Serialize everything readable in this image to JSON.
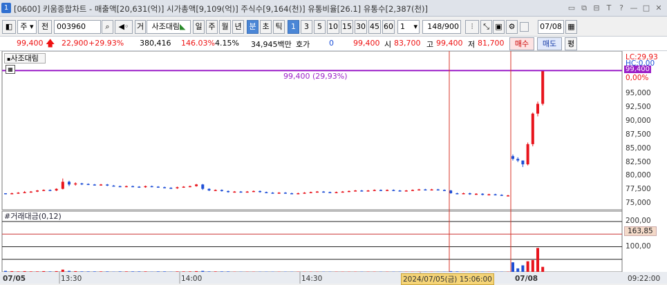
{
  "window": {
    "number": "1",
    "title": "[0600] 키움종합차트 - 매출액[20,631(억)] 시가총액[9,109(억)] 주식수[9,164(천)] 유통비율[26.1] 유통수[2,387(천)]"
  },
  "toolbar": {
    "period_button": "주",
    "prev_label": "전",
    "stock_code": "003960",
    "stock_name_prefix": "거",
    "stock_name": "사조대림",
    "periods": [
      "일",
      "주",
      "월",
      "년",
      "분",
      "초",
      "틱"
    ],
    "selected_period": "분",
    "intervals": [
      "1",
      "3",
      "5",
      "10",
      "15",
      "30",
      "45",
      "60"
    ],
    "selected_interval": "1",
    "interval_select_value": "1",
    "count": "148",
    "count_total": "/900",
    "date": "07/08"
  },
  "quote": {
    "price": "99,400",
    "change": "22,900",
    "change_pct": "+29.93%",
    "volume": "380,416",
    "volume_pct": "146.03%",
    "turnover": "4.15%",
    "amount": "34,945백만",
    "hoga_label": "호가",
    "hoga_value": "0",
    "ask": "99,400",
    "open_label": "시",
    "open": "83,700",
    "high_label": "고",
    "high": "99,400",
    "low_label": "저",
    "low": "81,700",
    "buy_button": "매수",
    "sell_button": "매도",
    "eval_button": "평"
  },
  "price_panel": {
    "stock_label": "사조대림",
    "annotation": "99,400 (29,93%)",
    "lc_label": "LC:29,93",
    "hc_label": "HC:0,00",
    "current_tag": "99,400",
    "pct_tag": "0,00%",
    "y_ticks": [
      "95,000",
      "92,500",
      "90,000",
      "87,500",
      "85,000",
      "82,500",
      "80,000",
      "77,500",
      "75,000"
    ]
  },
  "volume_panel": {
    "label": "#거래대금(0,12)",
    "y_ticks": [
      "200,00",
      "100,00"
    ],
    "current_tag": "163,85"
  },
  "x_axis": {
    "labels": [
      "07/05",
      "13:30",
      "14:00",
      "14:30",
      "07/08",
      "09:22:00"
    ],
    "cursor_time": "2024/07/05(금) 15:06:00"
  },
  "colors": {
    "up": "#e8141c",
    "down": "#1f4fd6",
    "accent_line": "#9b1fc8",
    "cursor_line": "#d8352a",
    "tag_red": "#e8141c",
    "tag_purple": "#9b1fc8"
  },
  "chart_data": {
    "type": "candlestick",
    "series": [
      {
        "name": "price",
        "values": [
          [
            76900,
            76900,
            76700,
            76800
          ],
          [
            76800,
            77000,
            76700,
            76900
          ],
          [
            76900,
            77100,
            76800,
            77000
          ],
          [
            77000,
            77300,
            76900,
            77100
          ],
          [
            77100,
            77300,
            77000,
            77200
          ],
          [
            77200,
            77500,
            77100,
            77400
          ],
          [
            77400,
            77600,
            77300,
            77500
          ],
          [
            77500,
            77600,
            77300,
            77400
          ],
          [
            77400,
            77800,
            77300,
            77700
          ],
          [
            77700,
            79600,
            77600,
            79000
          ],
          [
            79000,
            79200,
            78200,
            78500
          ],
          [
            78500,
            78900,
            78300,
            78700
          ],
          [
            78700,
            78800,
            78400,
            78600
          ],
          [
            78600,
            78700,
            78400,
            78500
          ],
          [
            78500,
            78600,
            78300,
            78400
          ],
          [
            78400,
            78600,
            78300,
            78500
          ],
          [
            78500,
            78600,
            78200,
            78300
          ],
          [
            78300,
            78400,
            78100,
            78200
          ],
          [
            78200,
            78300,
            78000,
            78100
          ],
          [
            78100,
            78300,
            78000,
            78200
          ],
          [
            78200,
            78300,
            78000,
            78100
          ],
          [
            78100,
            78200,
            77900,
            78000
          ],
          [
            78000,
            78300,
            77900,
            78200
          ],
          [
            78200,
            78300,
            78000,
            78100
          ],
          [
            78100,
            78200,
            77900,
            78000
          ],
          [
            78000,
            78100,
            77800,
            77900
          ],
          [
            77900,
            78000,
            77700,
            77800
          ],
          [
            77800,
            78100,
            77700,
            78000
          ],
          [
            78000,
            78200,
            77900,
            78100
          ],
          [
            78100,
            78300,
            78000,
            78200
          ],
          [
            78200,
            78600,
            78100,
            78500
          ],
          [
            78500,
            78600,
            77500,
            77700
          ],
          [
            77700,
            77800,
            77300,
            77400
          ],
          [
            77400,
            77600,
            77300,
            77500
          ],
          [
            77500,
            77600,
            77200,
            77300
          ],
          [
            77300,
            77400,
            77000,
            77100
          ],
          [
            77100,
            77300,
            77000,
            77200
          ],
          [
            77200,
            77300,
            77000,
            77100
          ],
          [
            77100,
            77300,
            77000,
            77200
          ],
          [
            77200,
            77400,
            77100,
            77300
          ],
          [
            77300,
            77400,
            77000,
            77100
          ],
          [
            77100,
            77200,
            76900,
            77000
          ],
          [
            77000,
            77100,
            76800,
            76900
          ],
          [
            76900,
            77100,
            76800,
            77000
          ],
          [
            77000,
            77100,
            76800,
            76900
          ],
          [
            76900,
            77000,
            76700,
            76800
          ],
          [
            76800,
            77000,
            76700,
            76900
          ],
          [
            76900,
            77100,
            76800,
            77000
          ],
          [
            77000,
            77200,
            76900,
            77100
          ],
          [
            77100,
            77300,
            77000,
            77200
          ],
          [
            77200,
            77300,
            77000,
            77100
          ],
          [
            77100,
            77200,
            76900,
            77000
          ],
          [
            77000,
            77200,
            76900,
            77100
          ],
          [
            77100,
            77300,
            77000,
            77200
          ],
          [
            77200,
            77400,
            77100,
            77300
          ],
          [
            77300,
            77500,
            77200,
            77400
          ],
          [
            77400,
            77500,
            77200,
            77300
          ],
          [
            77300,
            77500,
            77200,
            77400
          ],
          [
            77400,
            77600,
            77300,
            77500
          ],
          [
            77500,
            77600,
            77300,
            77400
          ],
          [
            77400,
            77600,
            77300,
            77500
          ],
          [
            77500,
            77600,
            77300,
            77400
          ],
          [
            77400,
            77500,
            77200,
            77300
          ],
          [
            77300,
            77500,
            77200,
            77400
          ],
          [
            77400,
            77600,
            77300,
            77500
          ],
          [
            77500,
            77700,
            77400,
            77600
          ],
          [
            77600,
            77700,
            77400,
            77500
          ],
          [
            77500,
            77700,
            77400,
            77600
          ],
          [
            77600,
            77700,
            77400,
            77500
          ],
          [
            77500,
            77600,
            77300,
            77400
          ],
          [
            77400,
            77500,
            76800,
            76900
          ],
          [
            76900,
            77000,
            76700,
            76800
          ],
          [
            76800,
            77000,
            76700,
            76900
          ],
          [
            76900,
            77000,
            76600,
            76700
          ],
          [
            76700,
            76900,
            76600,
            76800
          ],
          [
            76800,
            76900,
            76500,
            76600
          ],
          [
            76600,
            76800,
            76500,
            76700
          ],
          [
            76700,
            76800,
            76500,
            76600
          ],
          [
            76600,
            76700,
            76400,
            76500
          ],
          [
            76500,
            76600,
            76400,
            76500
          ],
          [
            83700,
            84000,
            82900,
            83200
          ],
          [
            83200,
            83500,
            82600,
            82900
          ],
          [
            82900,
            82900,
            81700,
            82200
          ],
          [
            82200,
            86200,
            82000,
            85900
          ],
          [
            85900,
            91700,
            85500,
            91500
          ],
          [
            91500,
            93700,
            91000,
            93300
          ],
          [
            93300,
            99400,
            93000,
            99400
          ]
        ]
      },
      {
        "name": "거래대금",
        "values": [
          4,
          3,
          2,
          3,
          2,
          2,
          3,
          2,
          3,
          9,
          4,
          3,
          2,
          2,
          2,
          2,
          2,
          1,
          2,
          2,
          2,
          2,
          2,
          1,
          2,
          2,
          1,
          2,
          2,
          2,
          3,
          4,
          2,
          2,
          2,
          2,
          1,
          1,
          1,
          1,
          1,
          1,
          1,
          1,
          1,
          1,
          1,
          1,
          1,
          1,
          1,
          1,
          1,
          1,
          1,
          1,
          1,
          1,
          1,
          1,
          1,
          1,
          1,
          1,
          1,
          1,
          1,
          1,
          1,
          1,
          3,
          2,
          1,
          1,
          1,
          1,
          1,
          1,
          1,
          1,
          38,
          14,
          26,
          42,
          47,
          95,
          20
        ]
      }
    ],
    "ylim": [
      75000,
      99400
    ],
    "volume_ylim": [
      0,
      200
    ],
    "reference_line": 99400
  }
}
